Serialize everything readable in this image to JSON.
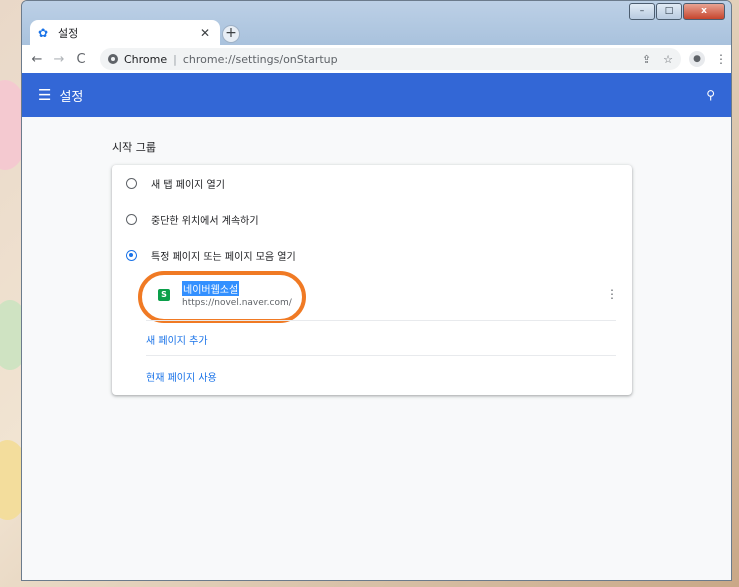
{
  "tab": {
    "title": "설정"
  },
  "window_buttons": {
    "min": "–",
    "max": "□",
    "close": "x"
  },
  "toolbar": {
    "omnibox_site": "Chrome",
    "omnibox_separator": "|",
    "omnibox_url": "chrome://settings/onStartup"
  },
  "header": {
    "title": "설정"
  },
  "startup": {
    "section_title": "시작 그룹",
    "options": [
      {
        "label": "새 탭 페이지 열기",
        "checked": false
      },
      {
        "label": "중단한 위치에서 계속하기",
        "checked": false
      },
      {
        "label": "특정 페이지 또는 페이지 모음 열기",
        "checked": true
      }
    ],
    "page_entry": {
      "favicon_text": "S",
      "name": "네이버웹소설",
      "url": "https://novel.naver.com/"
    },
    "links": {
      "add_page": "새 페이지 추가",
      "use_current": "현재 페이지 사용"
    }
  },
  "colors": {
    "header_bg": "#3367d6",
    "accent": "#1a73e8",
    "highlight": "#f07a24",
    "selection": "#3390ff",
    "favicon": "#0b9f4a"
  },
  "icons": {
    "tab": "gear-icon",
    "back": "back-arrow-icon",
    "forward": "forward-arrow-icon",
    "reload": "reload-icon",
    "share": "share-icon",
    "bookmark": "star-icon",
    "profile": "person-icon",
    "menu": "kebab-menu-icon",
    "hamburger": "hamburger-icon",
    "search": "search-icon"
  }
}
